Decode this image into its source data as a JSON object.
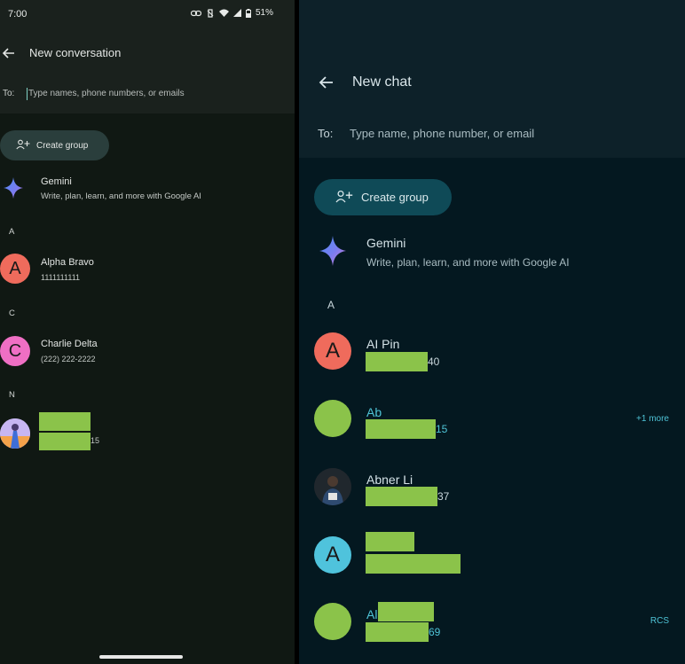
{
  "left": {
    "status": {
      "time": "7:00",
      "battery": "51%"
    },
    "header": {
      "title": "New conversation"
    },
    "to": {
      "label": "To:",
      "placeholder": "Type names, phone numbers, or emails"
    },
    "create_group_label": "Create group",
    "gemini": {
      "name": "Gemini",
      "description": "Write, plan, learn, and more with Google AI"
    },
    "sections": [
      {
        "letter": "A",
        "contacts": [
          {
            "initial": "A",
            "name": "Alpha Bravo",
            "detail": "1111111111",
            "avatar_color": "#ef6b5c"
          }
        ]
      },
      {
        "letter": "C",
        "contacts": [
          {
            "initial": "C",
            "name": "Charlie Delta",
            "detail": "(222) 222-2222",
            "avatar_color": "#ef6fc4"
          }
        ]
      },
      {
        "letter": "N",
        "contacts": [
          {
            "photo": "photo-avatar-icon",
            "suffix": "15"
          }
        ]
      }
    ]
  },
  "right": {
    "header": {
      "title": "New chat"
    },
    "to": {
      "label": "To:",
      "placeholder": "Type name, phone number, or email"
    },
    "create_group_label": "Create group",
    "gemini": {
      "name": "Gemini",
      "description": "Write, plan, learn, and more with Google AI"
    },
    "section_letter": "A",
    "contacts": [
      {
        "initial": "A",
        "name": "AI Pin",
        "suffix": "40",
        "avatar_color": "#ef6b5c"
      },
      {
        "initial": "",
        "name": "Ab",
        "suffix": "15",
        "badge": "+1 more",
        "avatar_color": "#8bc34a"
      },
      {
        "photo": "photo-avatar-icon",
        "name": "Abner Li",
        "suffix": "37"
      },
      {
        "initial": "A",
        "avatar_color": "#4fc3dc"
      },
      {
        "initial": "",
        "name": "Al",
        "suffix": "69",
        "badge": "RCS",
        "avatar_color": "#8bc34a"
      }
    ]
  },
  "colors": {
    "redaction": "#8bc34a",
    "accent": "#4fc3d6"
  }
}
